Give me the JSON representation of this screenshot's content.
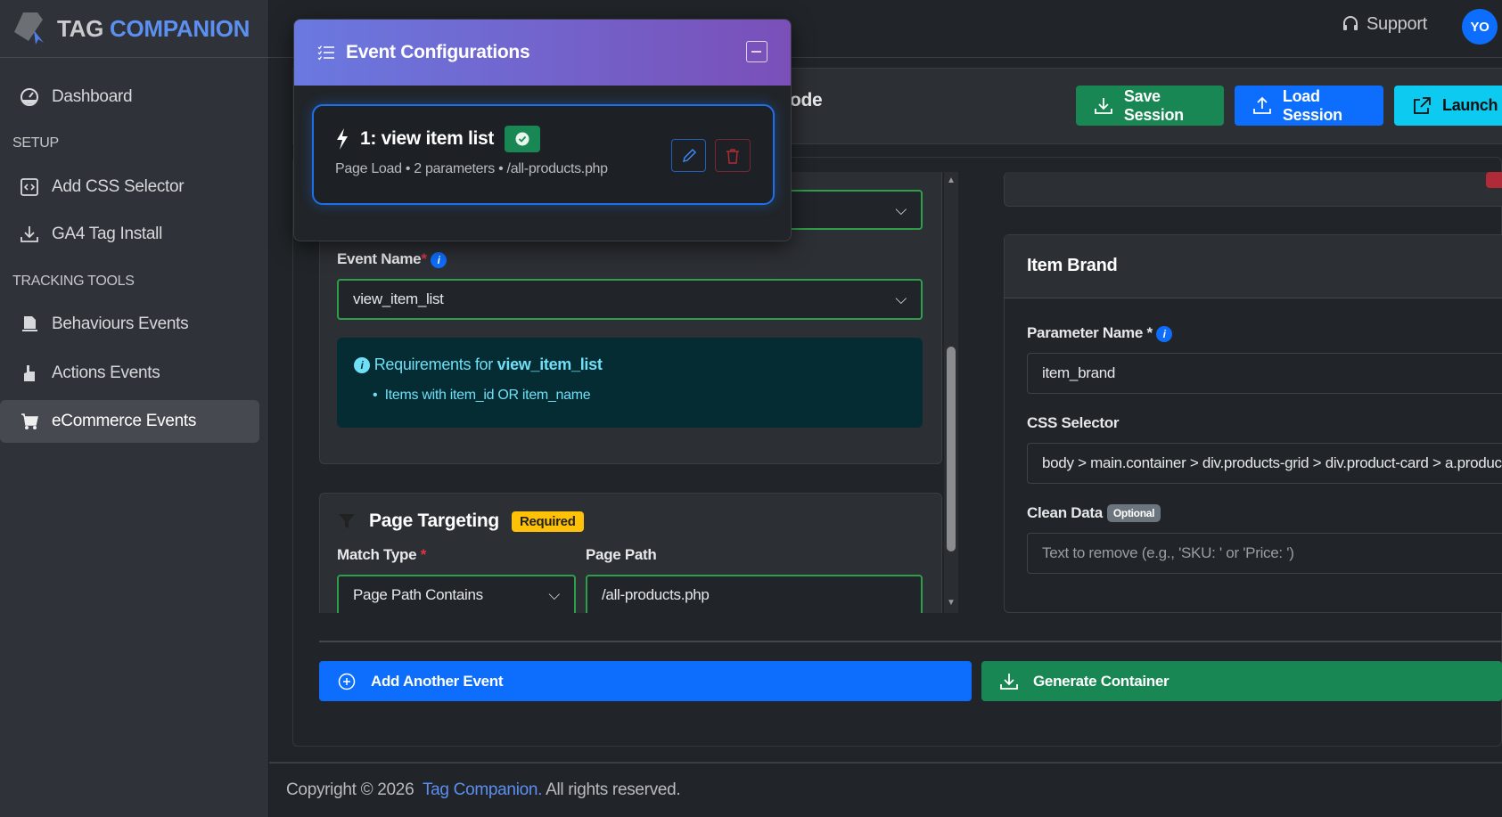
{
  "brand": {
    "part1": "TAG",
    "part2": "COMPANION"
  },
  "sidebar": {
    "dashboard": "Dashboard",
    "setup": "SETUP",
    "add_css": "Add CSS Selector",
    "ga4": "GA4 Tag Install",
    "tracking": "TRACKING TOOLS",
    "behaviours": "Behaviours Events",
    "actions": "Actions Events",
    "ecommerce": "eCommerce Events"
  },
  "header": {
    "support": "Support",
    "avatar": "YO"
  },
  "toolbar": {
    "heading_partial": "ode",
    "save": "Save Session",
    "load": "Load Session",
    "launch": "Launch W"
  },
  "form": {
    "event_name_label": "Event Name",
    "required_mark": "*",
    "event_name_value": "view_item_list",
    "req_title_prefix": "Requirements for",
    "req_title_event": "view_item_list",
    "req_item": "Items with item_id OR item_name",
    "page_targeting": "Page Targeting",
    "required_badge": "Required",
    "match_type_label": "Match Type",
    "match_type_value": "Page Path Contains",
    "page_path_label": "Page Path",
    "page_path_value": "/all-products.php"
  },
  "param": {
    "title": "Item Brand",
    "name_label": "Parameter Name",
    "name_req": "*",
    "name_value": "item_brand",
    "css_label": "CSS Selector",
    "css_value": "body > main.container > div.products-grid > div.product-card > a.product-link",
    "clean_label": "Clean Data",
    "optional_badge": "Optional",
    "clean_placeholder": "Text to remove (e.g., 'SKU: ' or 'Price: ')"
  },
  "actions": {
    "add_event": "Add Another Event",
    "generate": "Generate Container"
  },
  "footer": {
    "prefix": "Copyright © 2026",
    "link": "Tag Companion.",
    "suffix": "All rights reserved."
  },
  "overlay": {
    "title": "Event Configurations",
    "event_title": "1: view item list",
    "event_meta": "Page Load • 2 parameters • /all-products.php"
  }
}
